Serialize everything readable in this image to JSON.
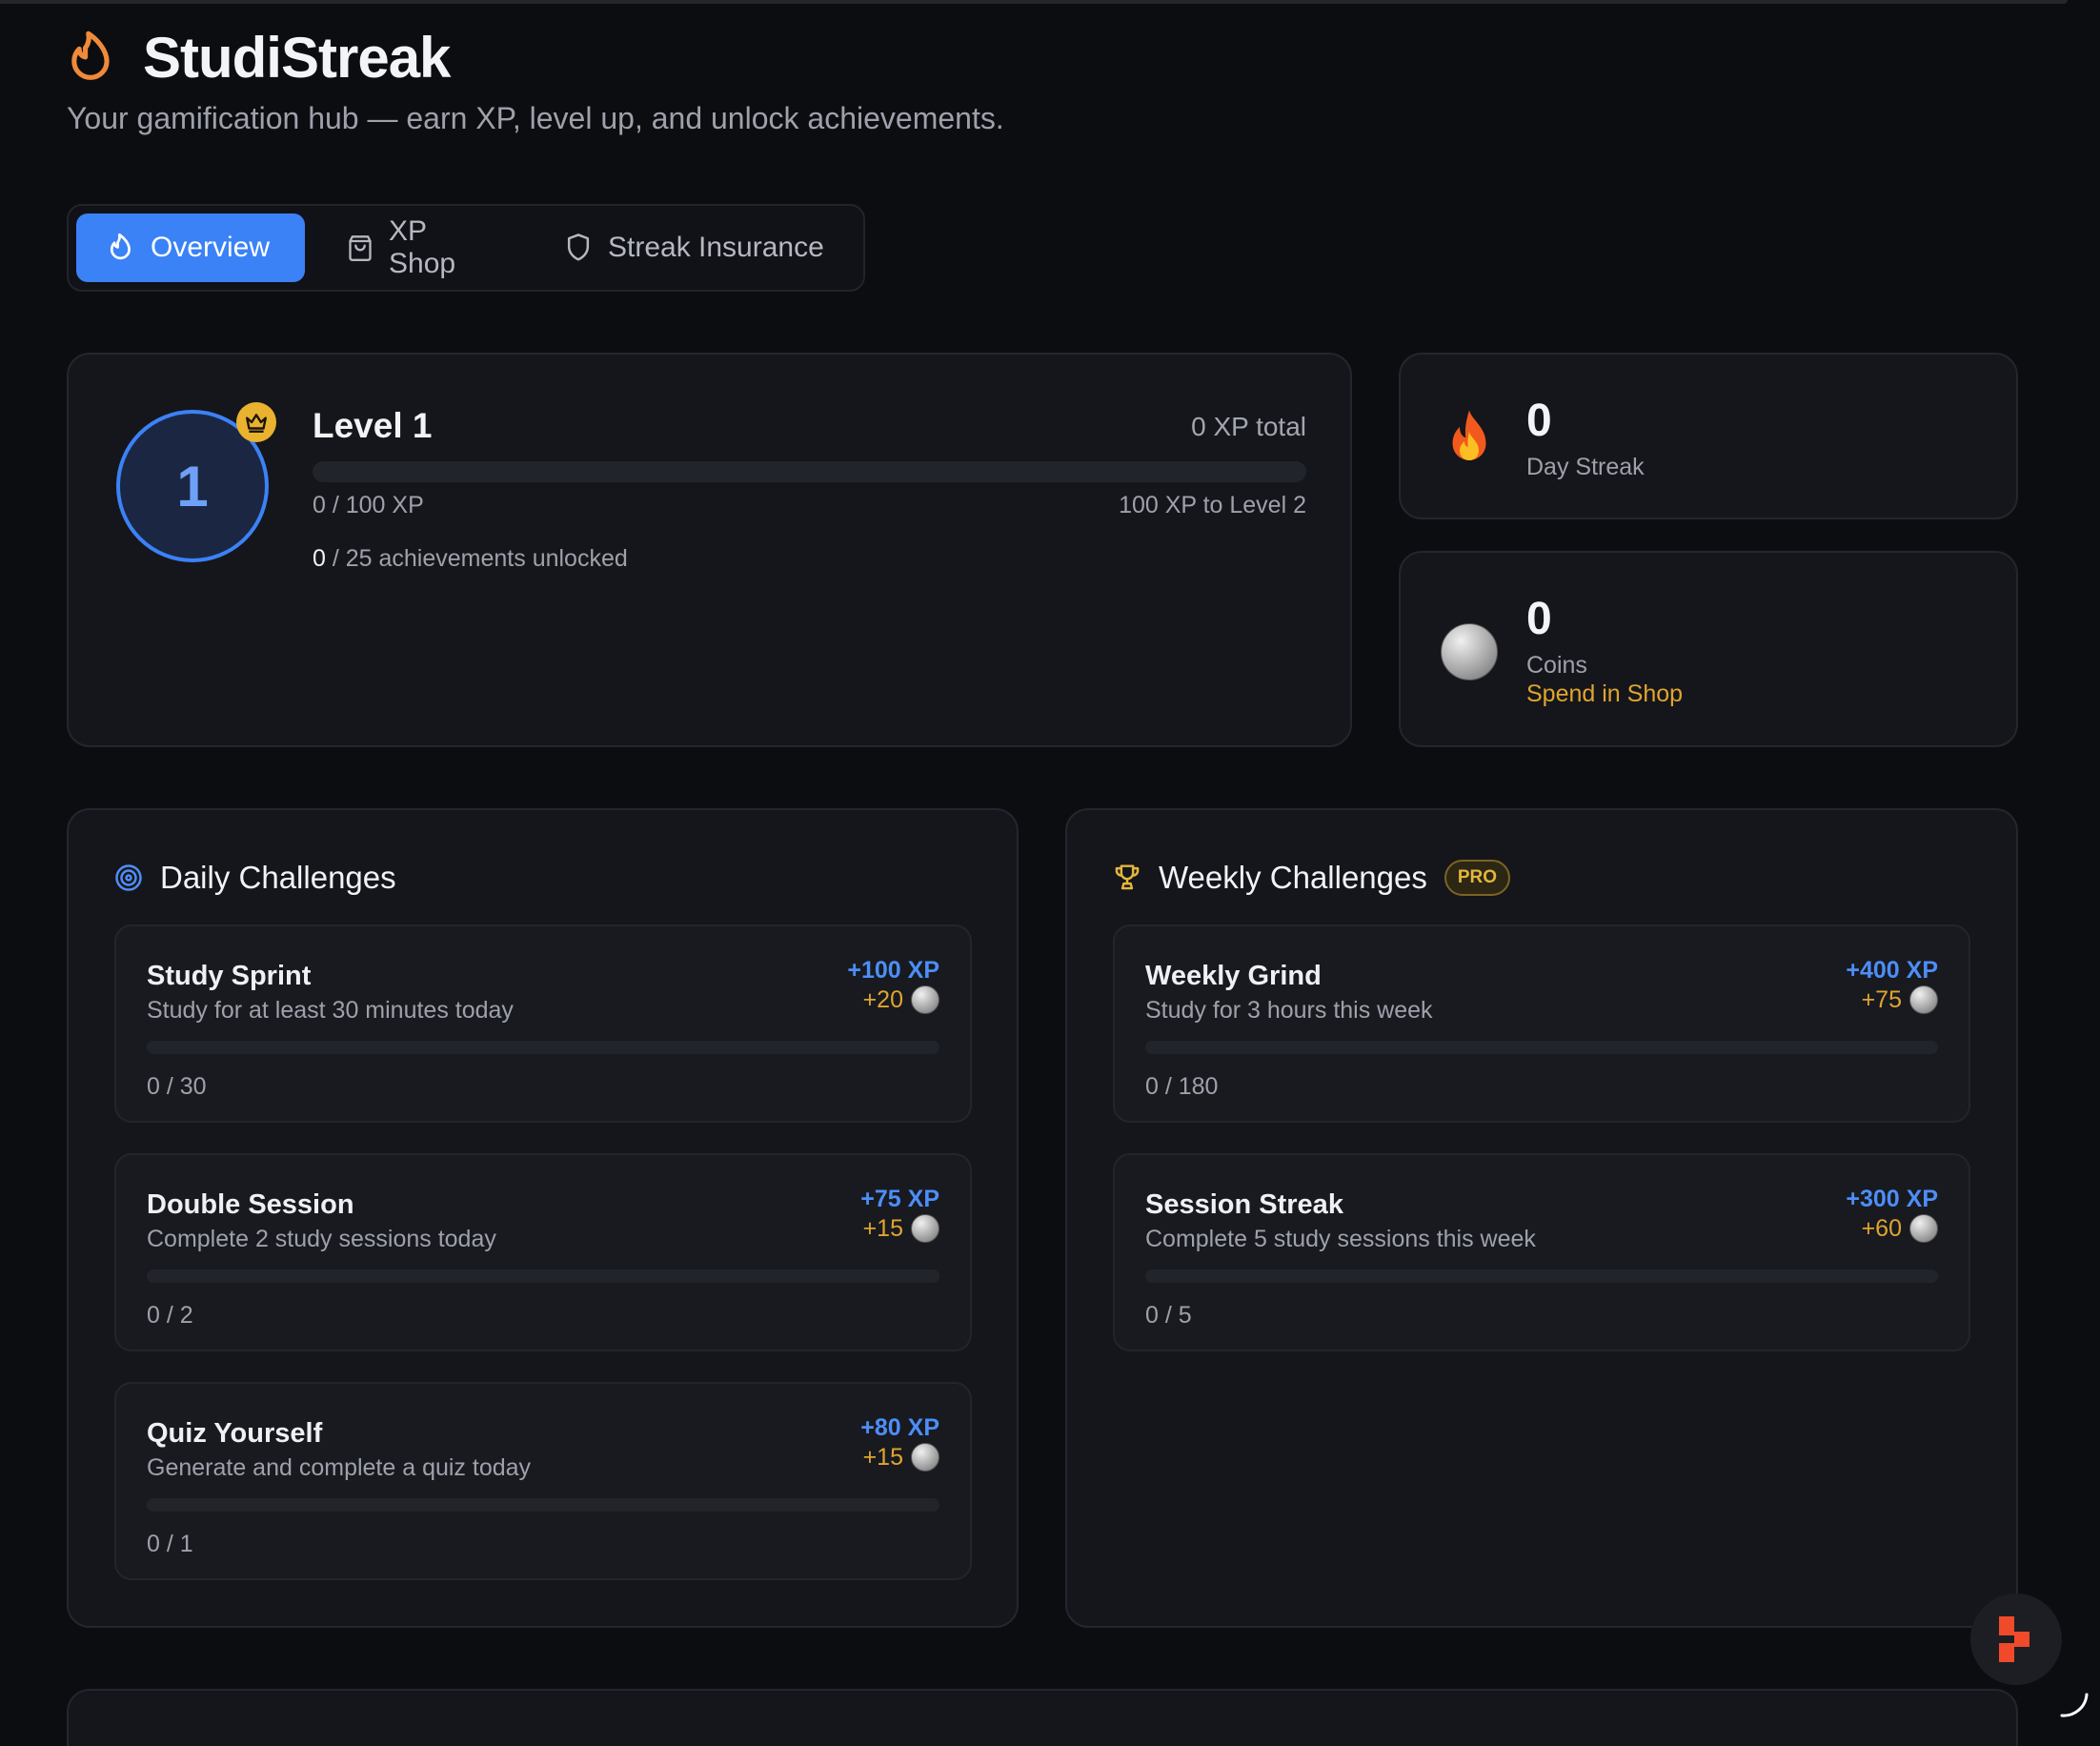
{
  "app": {
    "title": "StudiStreak",
    "subtitle": "Your gamification hub — earn XP, level up, and unlock achievements."
  },
  "tabs": [
    {
      "label": "Overview",
      "icon": "flame-icon",
      "active": true
    },
    {
      "label": "XP Shop",
      "icon": "shopping-bag-icon",
      "active": false
    },
    {
      "label": "Streak Insurance",
      "icon": "shield-icon",
      "active": false
    }
  ],
  "level": {
    "number": "1",
    "title": "Level 1",
    "xp_total": "0 XP total",
    "progress": 0,
    "xp_progress": "0 / 100 XP",
    "xp_to_next": "100 XP to Level 2",
    "achievements_unlocked": "0",
    "achievements_rest": "/ 25 achievements unlocked",
    "badge_icon": "crown-icon"
  },
  "streak": {
    "value": "0",
    "label": "Day Streak",
    "icon": "fire-icon"
  },
  "coins": {
    "value": "0",
    "label": "Coins",
    "link": "Spend in Shop",
    "icon": "coin-icon"
  },
  "daily": {
    "title": "Daily Challenges",
    "icon": "target-icon",
    "items": [
      {
        "name": "Study Sprint",
        "desc": "Study for at least 30 minutes today",
        "xp": "+100 XP",
        "coins": "+20",
        "progress_text": "0 / 30",
        "progress": 0
      },
      {
        "name": "Double Session",
        "desc": "Complete 2 study sessions today",
        "xp": "+75 XP",
        "coins": "+15",
        "progress_text": "0 / 2",
        "progress": 0
      },
      {
        "name": "Quiz Yourself",
        "desc": "Generate and complete a quiz today",
        "xp": "+80 XP",
        "coins": "+15",
        "progress_text": "0 / 1",
        "progress": 0
      }
    ]
  },
  "weekly": {
    "title": "Weekly Challenges",
    "badge": "PRO",
    "icon": "trophy-icon",
    "items": [
      {
        "name": "Weekly Grind",
        "desc": "Study for 3 hours this week",
        "xp": "+400 XP",
        "coins": "+75",
        "progress_text": "0 / 180",
        "progress": 0
      },
      {
        "name": "Session Streak",
        "desc": "Complete 5 study sessions this week",
        "xp": "+300 XP",
        "coins": "+60",
        "progress_text": "0 / 5",
        "progress": 0
      }
    ]
  },
  "colors": {
    "accent": "#3b82f6",
    "gold": "#e0a52e",
    "background": "#0c0d11",
    "card": "#15161b"
  }
}
